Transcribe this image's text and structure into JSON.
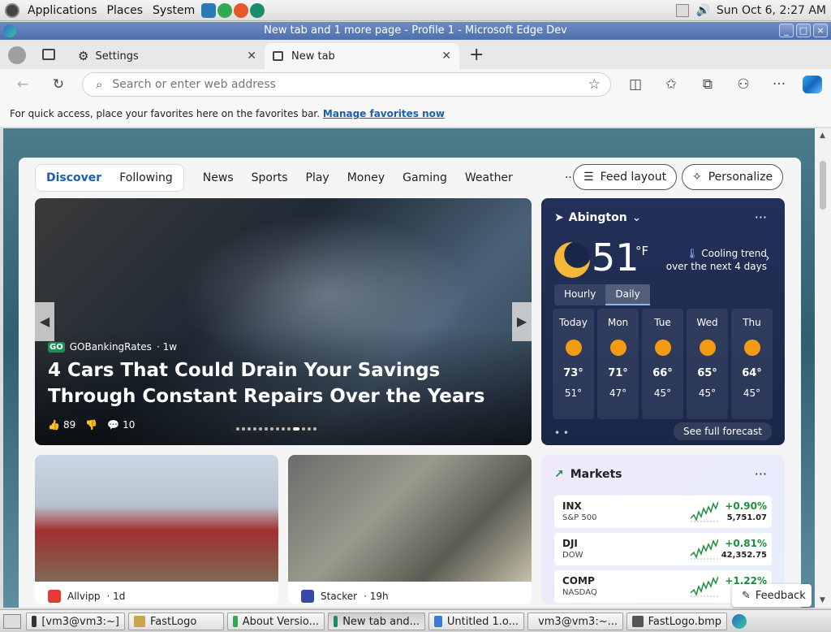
{
  "top_panel": {
    "menus": [
      "Applications",
      "Places",
      "System"
    ],
    "clock": "Sun Oct  6,  2:27 AM"
  },
  "window": {
    "title": "New tab and 1 more page - Profile 1 - Microsoft Edge Dev",
    "buttons": [
      "_",
      "□",
      "×"
    ]
  },
  "tabs": [
    {
      "label": "Settings",
      "active": false
    },
    {
      "label": "New tab",
      "active": true
    }
  ],
  "address_bar": {
    "placeholder": "Search or enter web address"
  },
  "favorites_bar": {
    "message": "For quick access, place your favorites here on the favorites bar.",
    "link": "Manage favorites now"
  },
  "feed": {
    "segment": [
      "Discover",
      "Following"
    ],
    "nav_items": [
      "News",
      "Sports",
      "Play",
      "Money",
      "Gaming",
      "Weather"
    ],
    "overflow": "···",
    "feed_layout_label": "Feed layout",
    "personalize_label": "Personalize"
  },
  "hero": {
    "source": "GOBankingRates",
    "source_badge": "GO",
    "age": "· 1w",
    "title": "4 Cars That Could Drain Your Savings Through Constant Repairs Over the Years",
    "likes": "89",
    "comments": "10",
    "page_dots": 14,
    "active_dot": 10
  },
  "weather": {
    "location": "Abington",
    "temperature": "51",
    "unit": "°F",
    "trend": "Cooling trend over the next 4 days",
    "tabs": [
      "Hourly",
      "Daily"
    ],
    "active_tab": "Daily",
    "days": [
      {
        "name": "Today",
        "high": "73°",
        "low": "51°"
      },
      {
        "name": "Mon",
        "high": "71°",
        "low": "47°"
      },
      {
        "name": "Tue",
        "high": "66°",
        "low": "45°"
      },
      {
        "name": "Wed",
        "high": "65°",
        "low": "45°"
      },
      {
        "name": "Thu",
        "high": "64°",
        "low": "45°"
      }
    ],
    "forecast_link": "See full forecast"
  },
  "cards": [
    {
      "source": "Allvipp",
      "age": "· 1d",
      "icon_color": "#e53935"
    },
    {
      "source": "Stacker",
      "age": "· 19h",
      "icon_color": "#3949ab"
    }
  ],
  "markets": {
    "title": "Markets",
    "rows": [
      {
        "symbol": "INX",
        "index": "S&P 500",
        "change": "+0.90%",
        "value": "5,751.07"
      },
      {
        "symbol": "DJI",
        "index": "DOW",
        "change": "+0.81%",
        "value": "42,352.75"
      },
      {
        "symbol": "COMP",
        "index": "NASDAQ",
        "change": "+1.22%",
        "value": ""
      }
    ]
  },
  "feedback_label": "Feedback",
  "taskbar": [
    {
      "label": "[vm3@vm3:~]",
      "icon": "terminal-icon"
    },
    {
      "label": "FastLogo",
      "icon": "folder-icon"
    },
    {
      "label": "About Versio...",
      "icon": "chrome-icon"
    },
    {
      "label": "New tab and...",
      "icon": "edge-icon",
      "active": true
    },
    {
      "label": "Untitled 1.o...",
      "icon": "document-icon"
    },
    {
      "label": "vm3@vm3:~...",
      "icon": "terminal-icon"
    },
    {
      "label": "FastLogo.bmp",
      "icon": "image-icon"
    }
  ],
  "colors": {
    "accent": "#1a5fb4",
    "title_bar": "#4e6fae",
    "market_up": "#1e8e3e",
    "weather_bg": "#23315a"
  }
}
